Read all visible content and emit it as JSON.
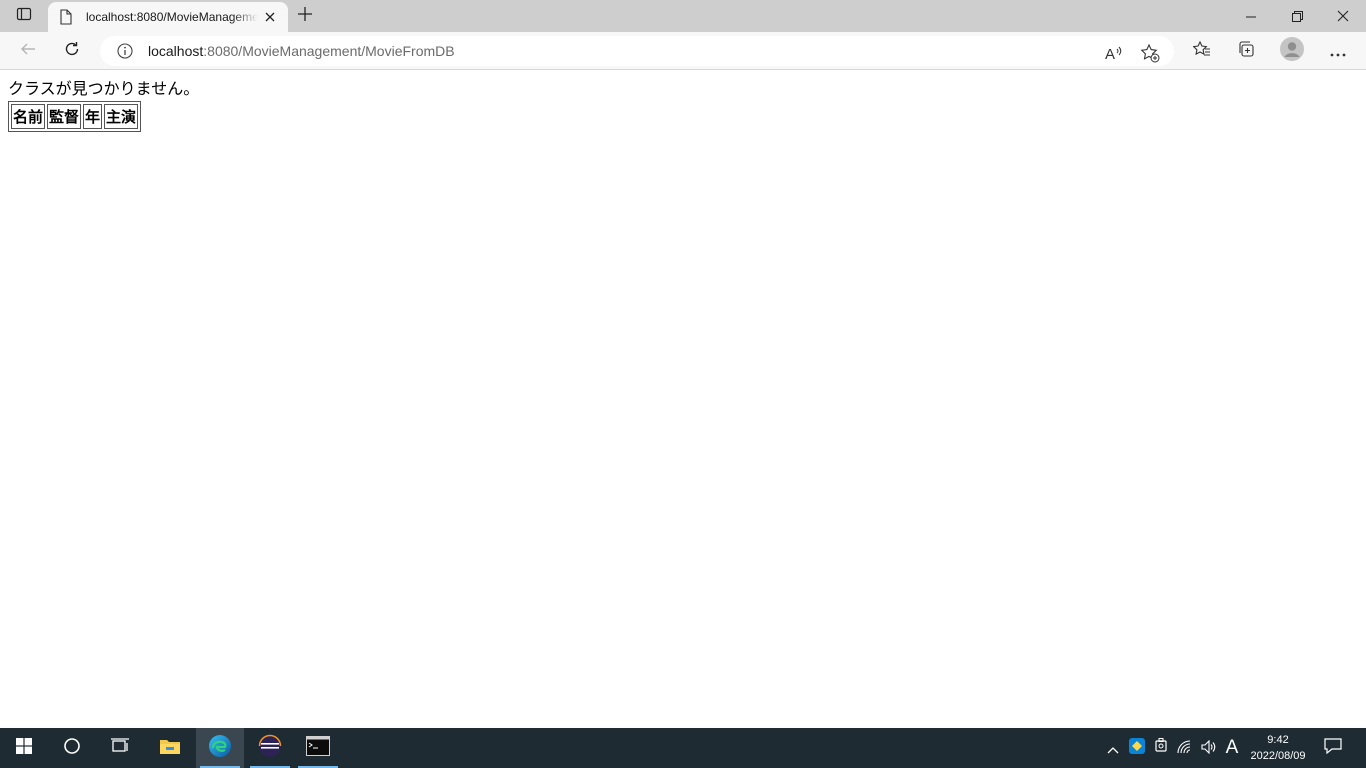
{
  "browser": {
    "tab": {
      "title": "localhost:8080/MovieManagement/MovieFromDB"
    },
    "address": {
      "host": "localhost",
      "rest": ":8080/MovieManagement/MovieFromDB"
    }
  },
  "page": {
    "message": "クラスが見つかりません。",
    "table": {
      "headers": [
        "名前",
        "監督",
        "年",
        "主演"
      ]
    }
  },
  "taskbar": {
    "ime": "A",
    "time": "9:42",
    "date": "2022/08/09"
  }
}
